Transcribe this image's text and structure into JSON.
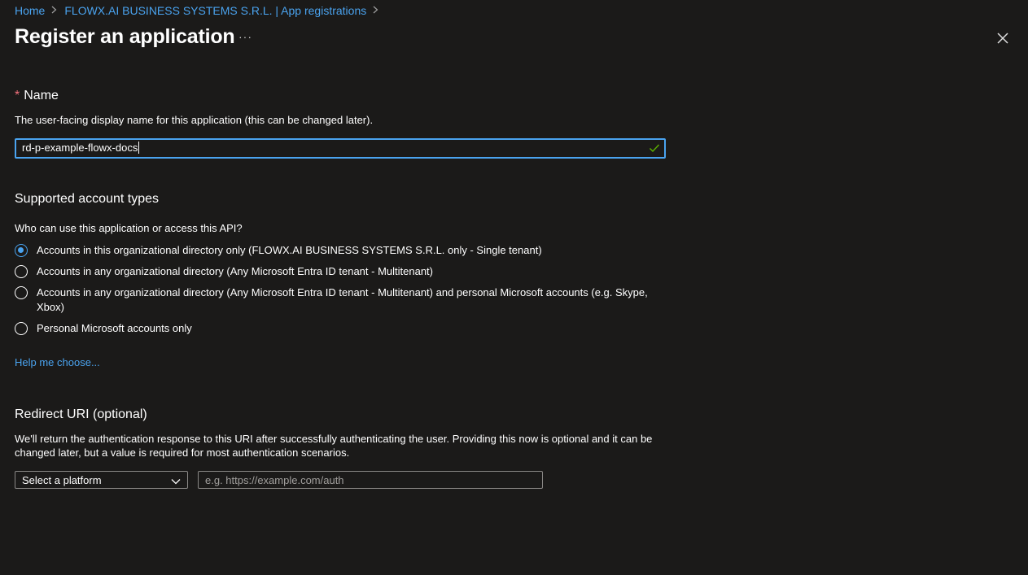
{
  "breadcrumb": {
    "home": "Home",
    "tenant": "FLOWX.AI BUSINESS SYSTEMS S.R.L. | App registrations"
  },
  "header": {
    "title": "Register an application",
    "more": "···"
  },
  "name_section": {
    "required_mark": "*",
    "label": "Name",
    "description": "The user-facing display name for this application (this can be changed later).",
    "value": "rd-p-example-flowx-docs"
  },
  "account_types": {
    "heading": "Supported account types",
    "question": "Who can use this application or access this API?",
    "options": [
      {
        "label": "Accounts in this organizational directory only (FLOWX.AI BUSINESS SYSTEMS S.R.L. only - Single tenant)",
        "selected": true
      },
      {
        "label": "Accounts in any organizational directory (Any Microsoft Entra ID tenant - Multitenant)",
        "selected": false
      },
      {
        "label": "Accounts in any organizational directory (Any Microsoft Entra ID tenant - Multitenant) and personal Microsoft accounts (e.g. Skype, Xbox)",
        "selected": false
      },
      {
        "label": "Personal Microsoft accounts only",
        "selected": false
      }
    ],
    "help_link": "Help me choose..."
  },
  "redirect": {
    "heading": "Redirect URI (optional)",
    "description": "We'll return the authentication response to this URI after successfully authenticating the user. Providing this now is optional and it can be changed later, but a value is required for most authentication scenarios.",
    "platform_select": "Select a platform",
    "uri_placeholder": "e.g. https://example.com/auth",
    "uri_value": ""
  },
  "colors": {
    "background": "#1b1a19",
    "accent": "#4aa3ef",
    "required": "#f1707b",
    "valid_check": "#5db300"
  },
  "icons": [
    "chevron-right-icon",
    "more-icon",
    "close-icon",
    "checkmark-icon",
    "chevron-down-icon"
  ]
}
